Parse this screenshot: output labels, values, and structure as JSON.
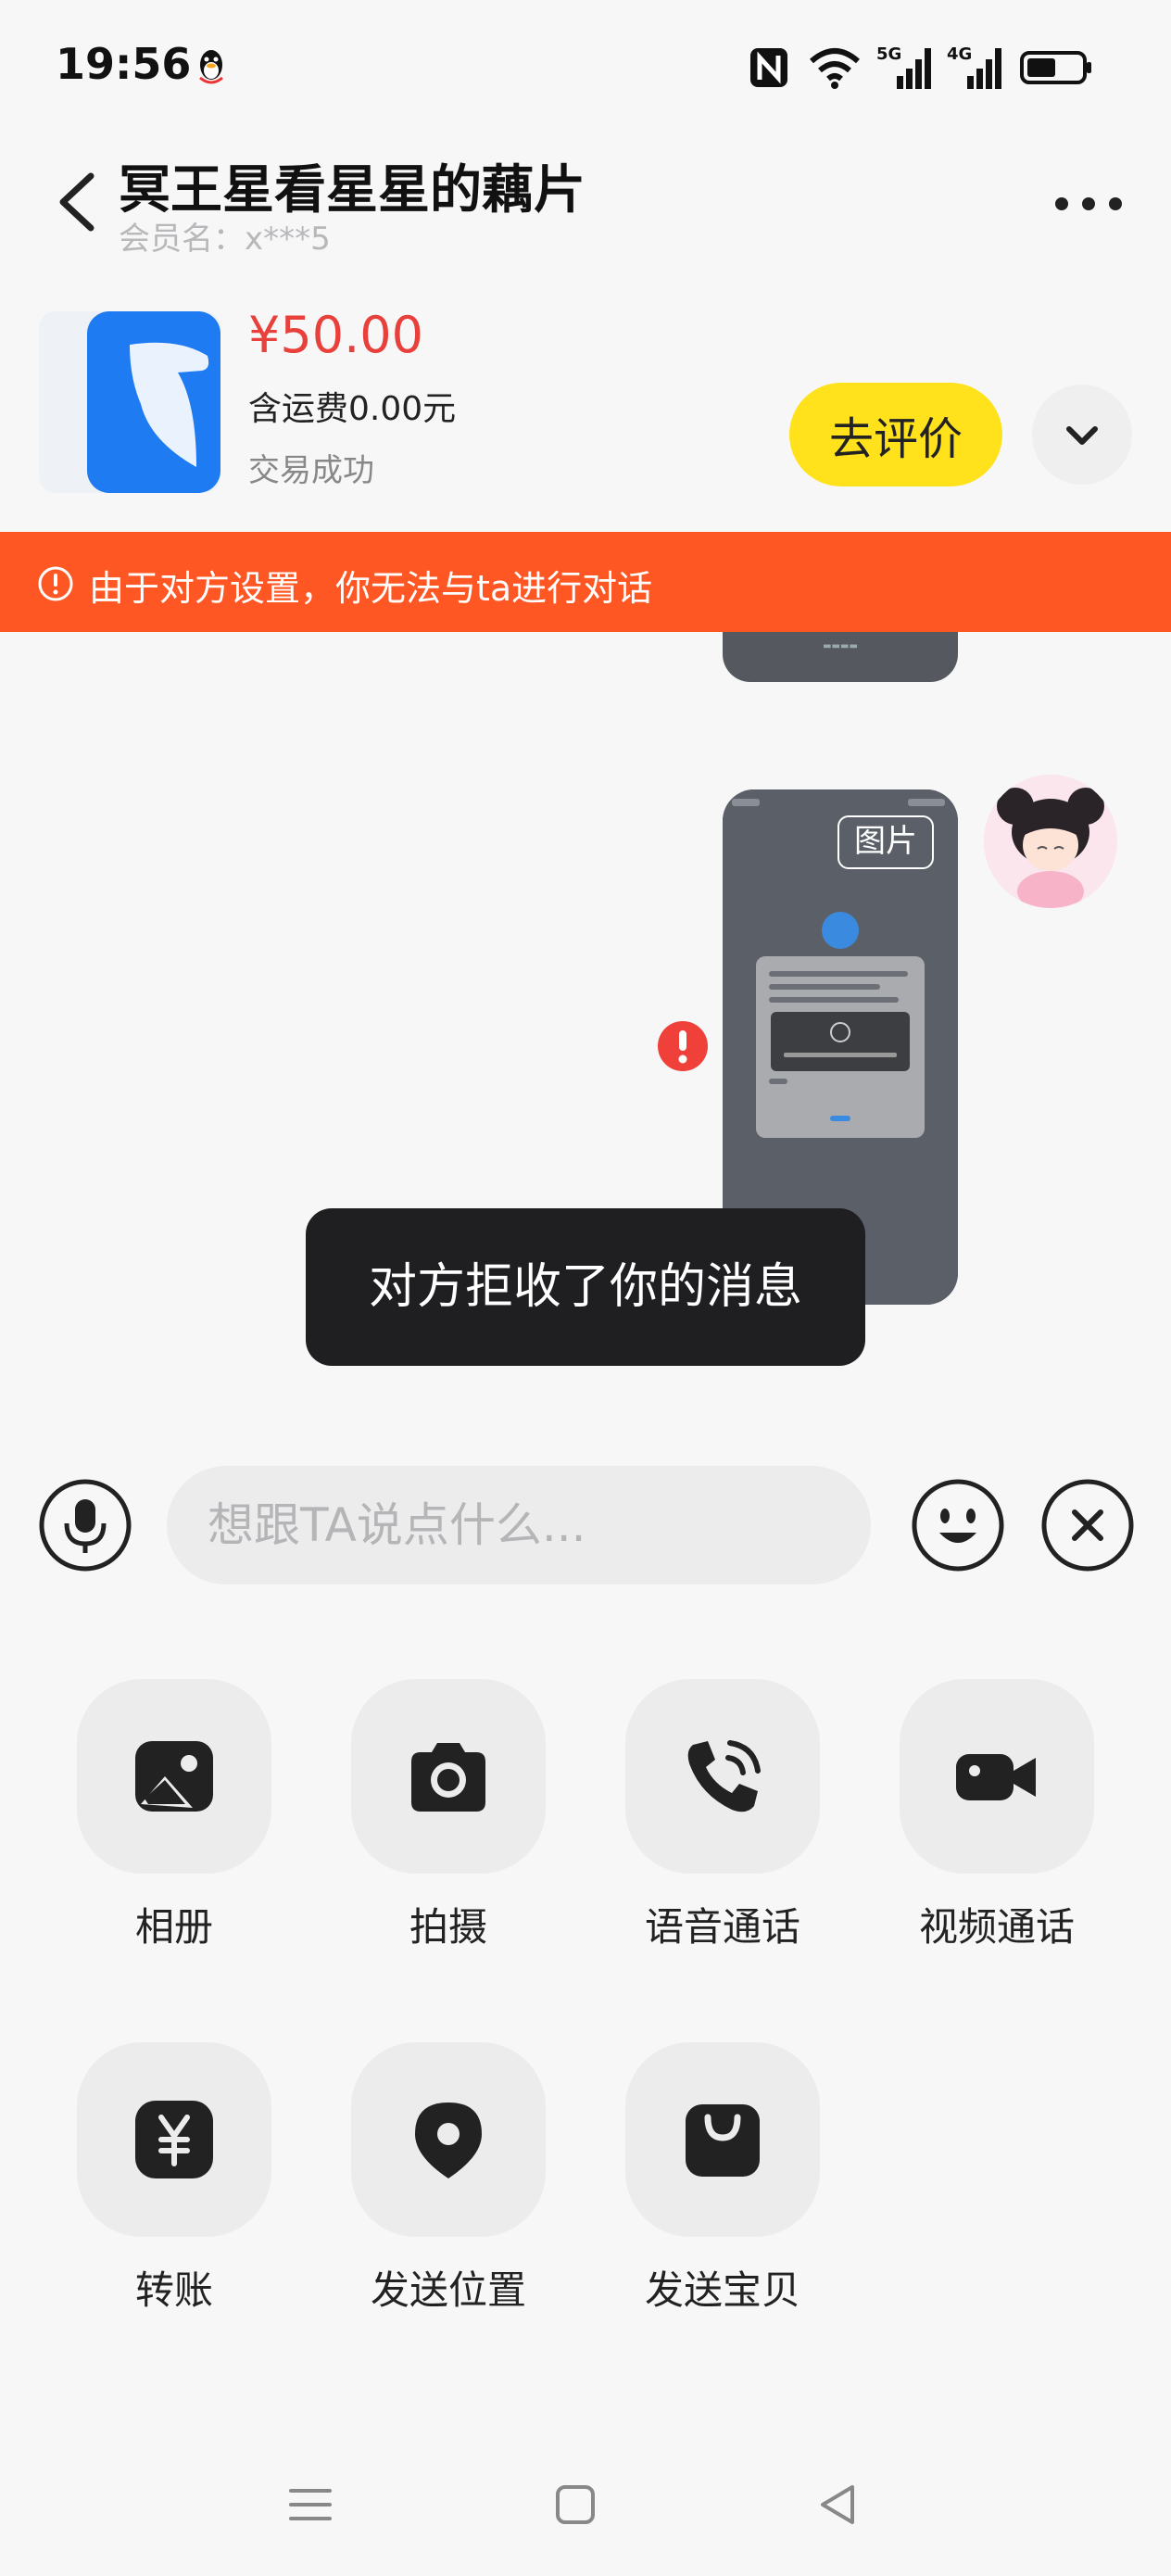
{
  "status_bar": {
    "time": "19:56",
    "net1": "5G",
    "net2": "4G"
  },
  "header": {
    "title": "冥王星看星星的藕片",
    "member_label": "会员名：x***5"
  },
  "product": {
    "price": "¥50.00",
    "shipping": "含运费0.00元",
    "status": "交易成功",
    "review_button": "去评价"
  },
  "banner": {
    "text": "由于对方设置，你无法与ta进行对话"
  },
  "messages": {
    "image_tag": "图片",
    "toast": "对方拒收了你的消息"
  },
  "input": {
    "placeholder": "想跟TA说点什么..."
  },
  "tools": [
    {
      "label": "相册",
      "icon": "album-icon"
    },
    {
      "label": "拍摄",
      "icon": "camera-icon"
    },
    {
      "label": "语音通话",
      "icon": "voice-call-icon"
    },
    {
      "label": "视频通话",
      "icon": "video-call-icon"
    },
    {
      "label": "转账",
      "icon": "transfer-icon"
    },
    {
      "label": "发送位置",
      "icon": "location-icon"
    },
    {
      "label": "发送宝贝",
      "icon": "shopping-bag-icon"
    }
  ],
  "colors": {
    "accent_yellow": "#ffe11c",
    "banner_orange": "#ff5724",
    "price_red": "#e8403a"
  }
}
